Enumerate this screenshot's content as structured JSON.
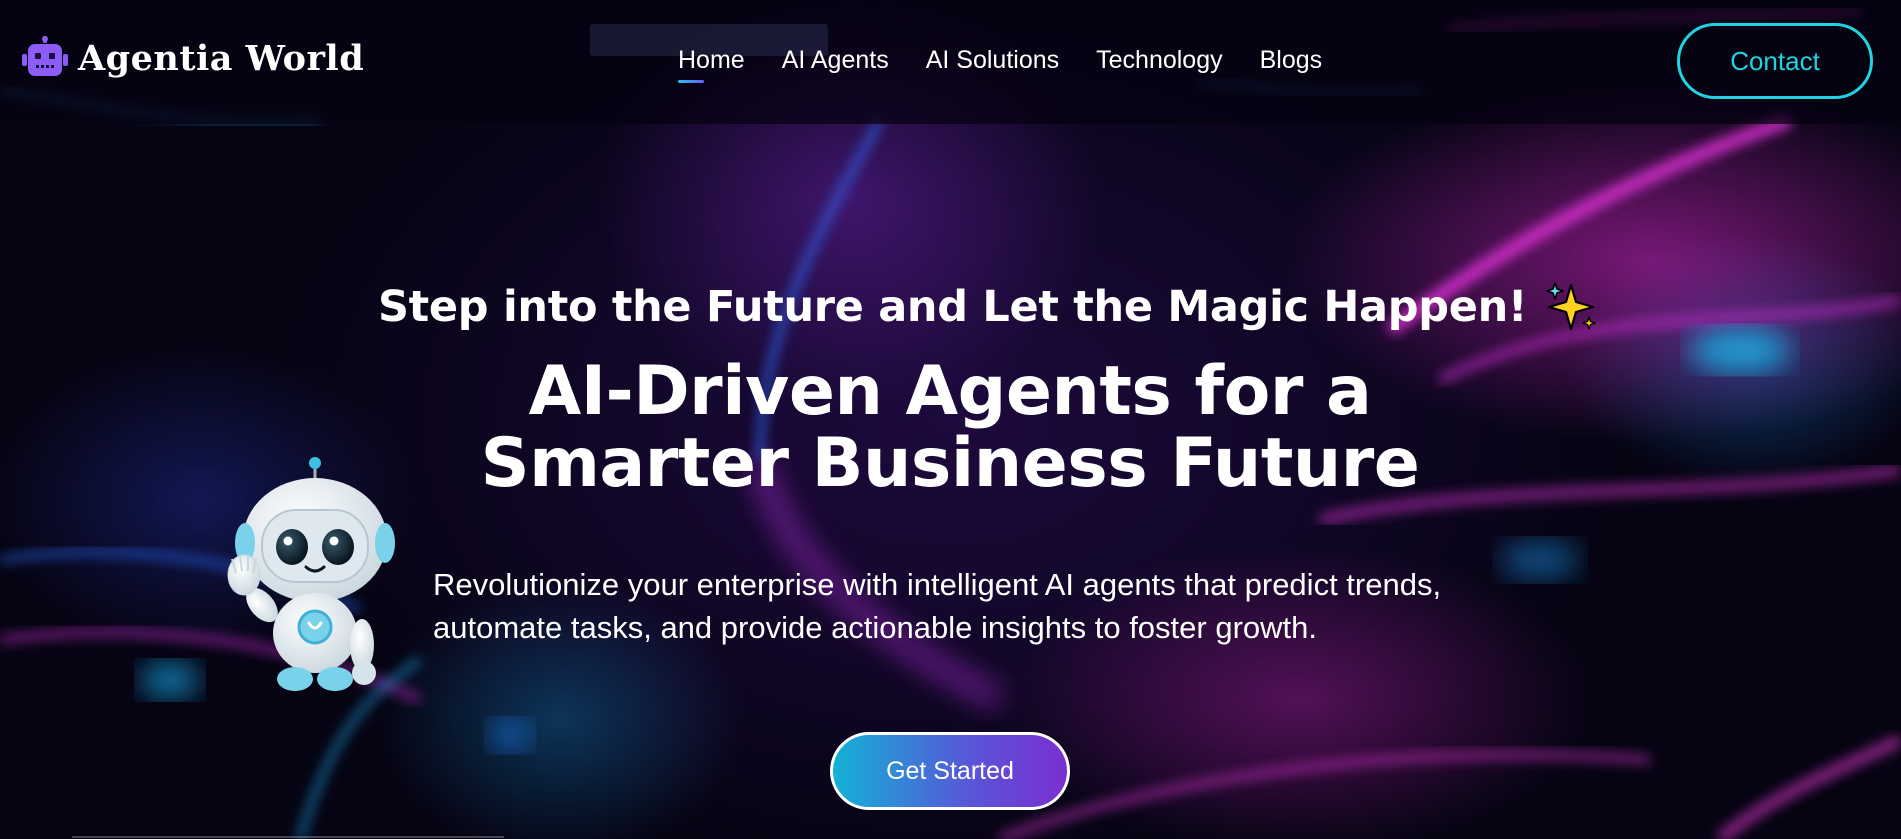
{
  "header": {
    "brand": "Agentia World",
    "brand_icon": "robot-icon",
    "nav": [
      {
        "label": "Home",
        "active": true
      },
      {
        "label": "AI Agents",
        "active": false
      },
      {
        "label": "AI Solutions",
        "active": false
      },
      {
        "label": "Technology",
        "active": false
      },
      {
        "label": "Blogs",
        "active": false
      }
    ],
    "contact_label": "Contact"
  },
  "hero": {
    "tagline": "Step into the Future and Let the Magic Happen!",
    "tagline_icon": "sparkles-icon",
    "headline_line1": "AI-Driven Agents for a",
    "headline_line2": "Smarter Business Future",
    "description_line1": "Revolutionize your enterprise with intelligent AI agents that predict trends,",
    "description_line2": "automate tasks, and provide actionable insights to foster growth.",
    "cta_label": "Get Started",
    "illustration": "waving-robot-mascot"
  },
  "colors": {
    "accent_cyan": "#1fd4e0",
    "accent_purple": "#7a2fd0",
    "brand_icon": "#8b5cf6",
    "background": "#060413",
    "streak_magenta": "#d628c8"
  }
}
